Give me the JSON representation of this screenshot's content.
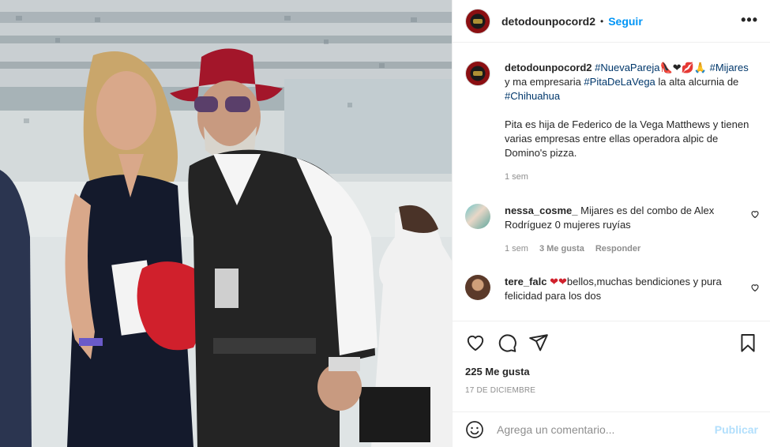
{
  "header": {
    "username": "detodounpocord2",
    "separator": "•",
    "follow_label": "Seguir",
    "more_label": "•••"
  },
  "caption": {
    "username": "detodounpocord2",
    "tag1": "#NuevaPareja",
    "emoji": "👠❤💋🙏",
    "tag2": "#Mijares",
    "text1": " y ma empresaria ",
    "tag3": "#PitaDeLaVega",
    "text2": " la alta alcurnia de ",
    "tag4": "#Chihuahua",
    "paragraph": "Pita es hija de Federico de la Vega Matthews y tienen varias empresas entre ellas operadora alpic de Domino's pizza.",
    "time": "1 sem"
  },
  "comments": [
    {
      "username": "nessa_cosme_",
      "text": "Mijares es del combo de Alex Rodríguez 0 mujeres ruyías",
      "time": "1 sem",
      "likes": "3 Me gusta",
      "reply": "Responder"
    },
    {
      "username": "tere_falc",
      "emoji": "❤❤",
      "text": "bellos,muchas bendiciones y pura felicidad para los dos"
    }
  ],
  "actions": {
    "likes": "225 Me gusta",
    "date": "17 DE DICIEMBRE"
  },
  "add_comment": {
    "placeholder": "Agrega un comentario...",
    "post_label": "Publicar"
  },
  "icons": [
    "heart-icon",
    "comment-icon",
    "share-icon",
    "bookmark-icon",
    "emoji-icon",
    "more-options-icon"
  ]
}
